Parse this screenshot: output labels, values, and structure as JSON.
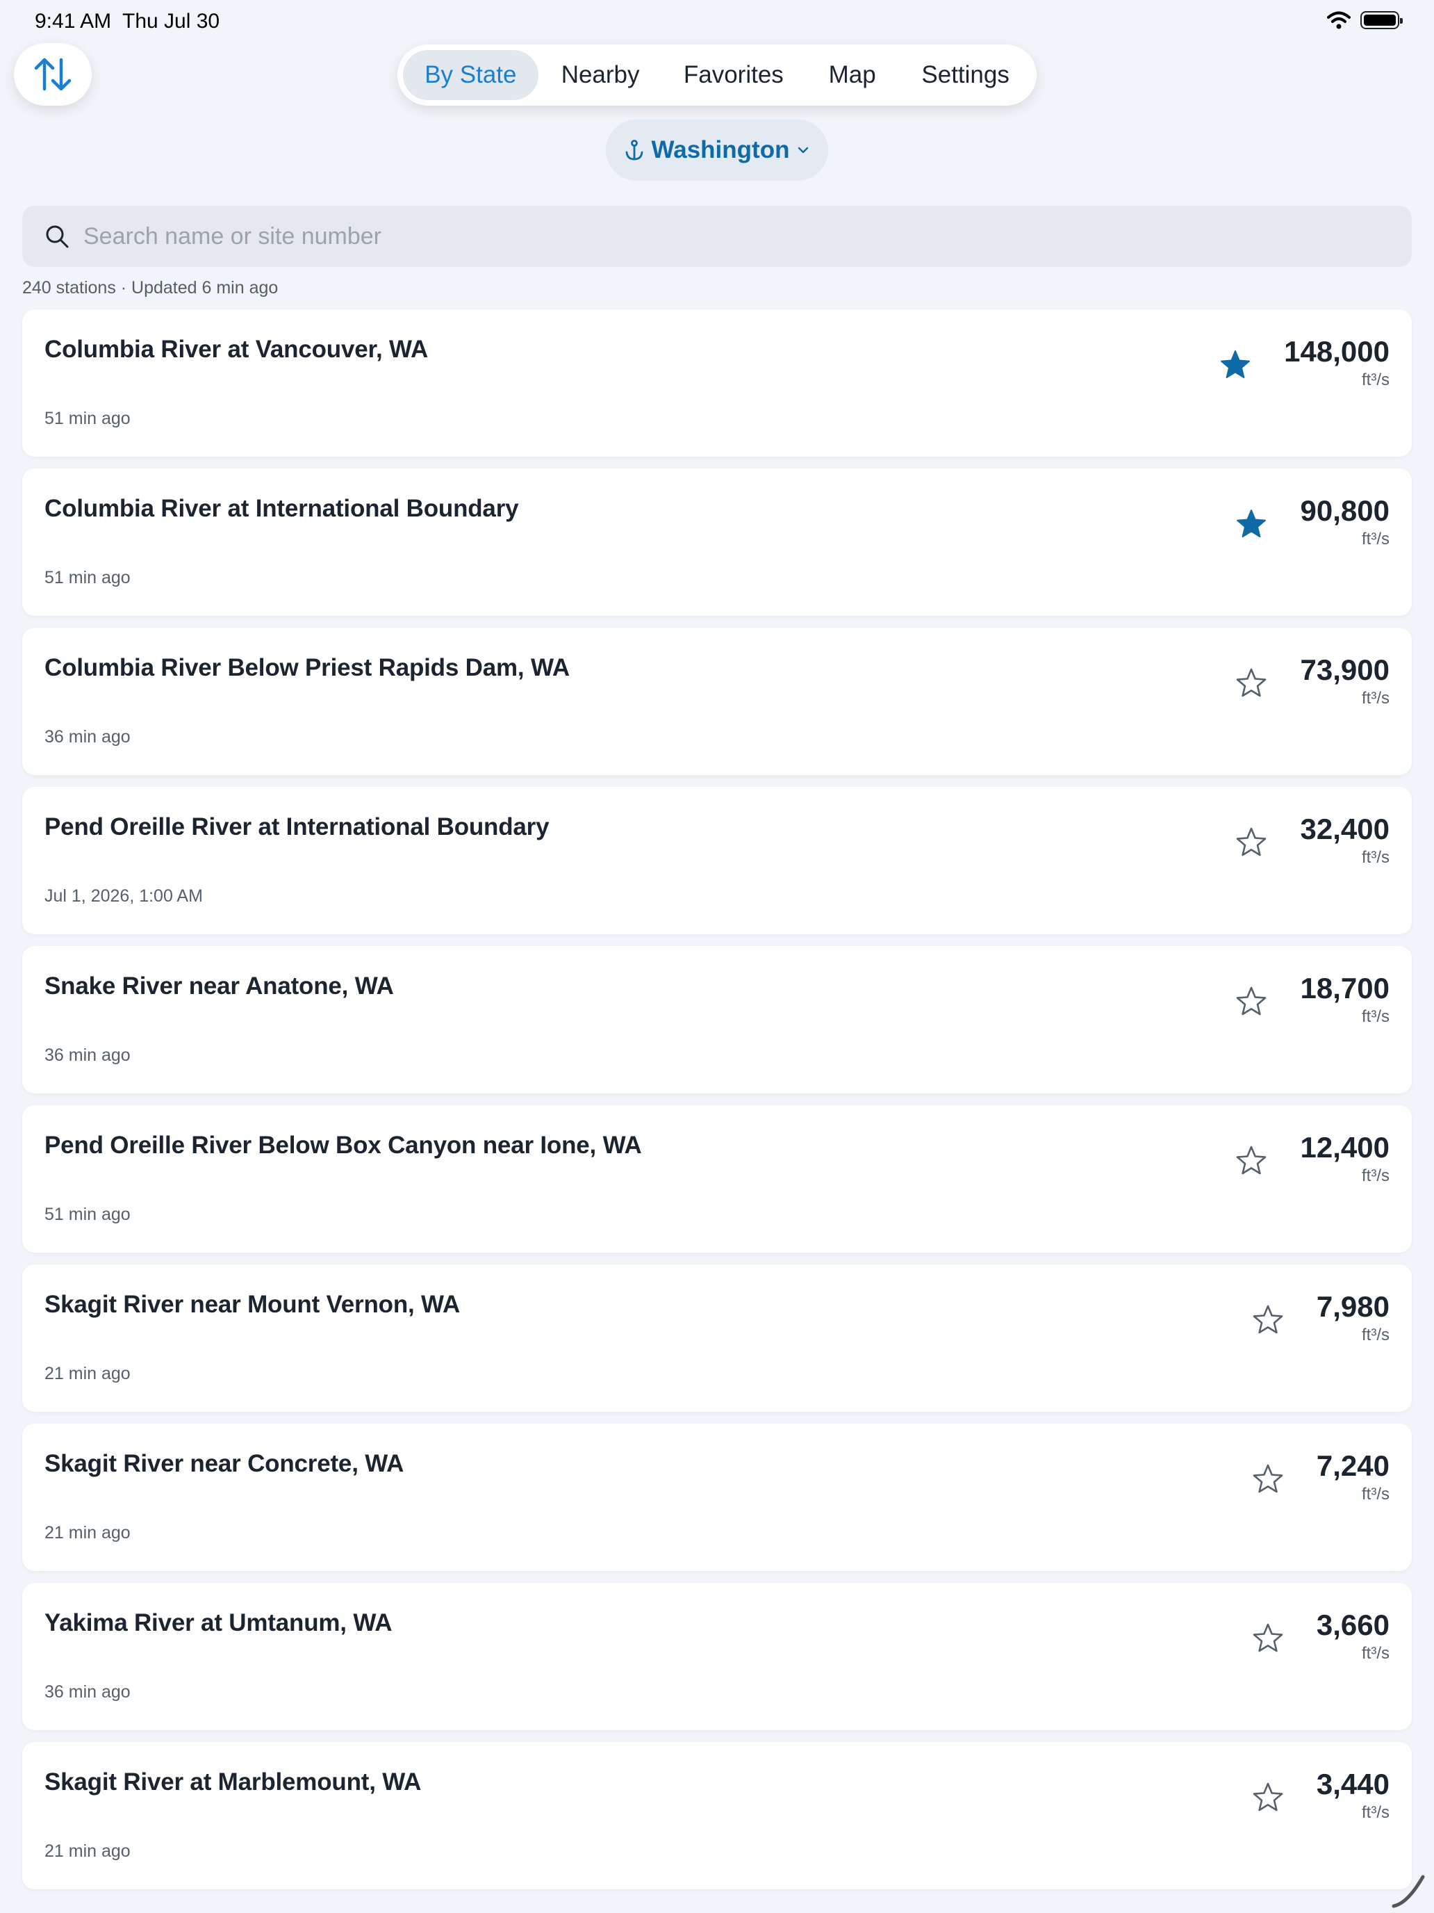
{
  "status_bar": {
    "time": "9:41 AM",
    "date": "Thu Jul 30"
  },
  "tabs": [
    {
      "label": "By State",
      "active": true
    },
    {
      "label": "Nearby",
      "active": false
    },
    {
      "label": "Favorites",
      "active": false
    },
    {
      "label": "Map",
      "active": false
    },
    {
      "label": "Settings",
      "active": false
    }
  ],
  "state_picker": {
    "label": "Washington",
    "icon": "anchor-icon"
  },
  "search": {
    "placeholder": "Search name or site number",
    "value": ""
  },
  "summary": "240 stations · Updated 6 min ago",
  "colors": {
    "accent": "#1A7FD0",
    "star_filled": "#0F6BA6",
    "background": "#F1F4F8"
  },
  "stations": [
    {
      "name": "Columbia River at Vancouver, WA",
      "updated": "51 min ago",
      "flow": "148,000",
      "unit": "ft³/s",
      "favorite": true
    },
    {
      "name": "Columbia River at International Boundary",
      "updated": "51 min ago",
      "flow": "90,800",
      "unit": "ft³/s",
      "favorite": true
    },
    {
      "name": "Columbia River Below Priest Rapids Dam, WA",
      "updated": "36 min ago",
      "flow": "73,900",
      "unit": "ft³/s",
      "favorite": false
    },
    {
      "name": "Pend Oreille River at International Boundary",
      "updated": "Jul 1, 2026, 1:00 AM",
      "flow": "32,400",
      "unit": "ft³/s",
      "favorite": false
    },
    {
      "name": "Snake River near Anatone, WA",
      "updated": "36 min ago",
      "flow": "18,700",
      "unit": "ft³/s",
      "favorite": false
    },
    {
      "name": "Pend Oreille River Below Box Canyon near Ione, WA",
      "updated": "51 min ago",
      "flow": "12,400",
      "unit": "ft³/s",
      "favorite": false
    },
    {
      "name": "Skagit River near Mount Vernon, WA",
      "updated": "21 min ago",
      "flow": "7,980",
      "unit": "ft³/s",
      "favorite": false
    },
    {
      "name": "Skagit River near Concrete, WA",
      "updated": "21 min ago",
      "flow": "7,240",
      "unit": "ft³/s",
      "favorite": false
    },
    {
      "name": "Yakima River at Umtanum, WA",
      "updated": "36 min ago",
      "flow": "3,660",
      "unit": "ft³/s",
      "favorite": false
    },
    {
      "name": "Skagit River at Marblemount, WA",
      "updated": "21 min ago",
      "flow": "3,440",
      "unit": "ft³/s",
      "favorite": false
    }
  ]
}
